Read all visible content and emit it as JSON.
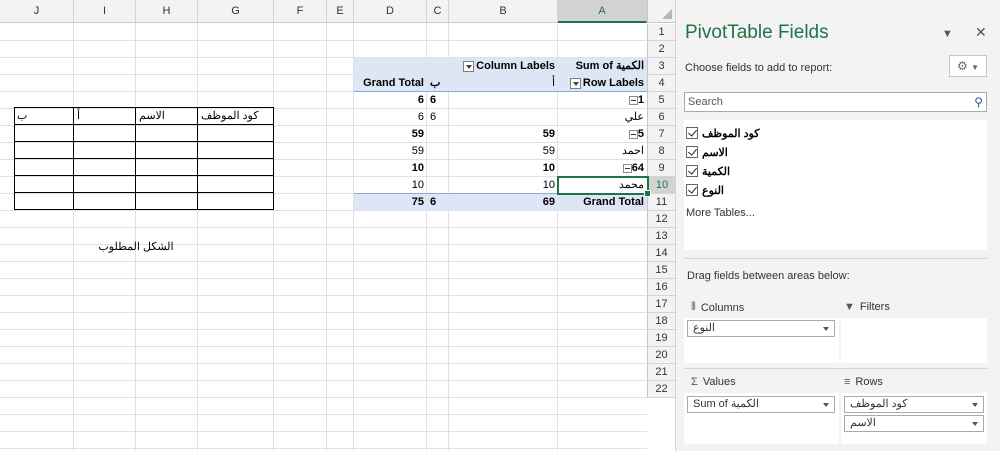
{
  "sheet": {
    "columns": [
      "J",
      "I",
      "H",
      "G",
      "F",
      "E",
      "D",
      "C",
      "B",
      "A"
    ],
    "selected_column": "A",
    "rows": [
      "1",
      "2",
      "3",
      "4",
      "5",
      "6",
      "7",
      "8",
      "9",
      "10",
      "11",
      "12",
      "13",
      "14",
      "15",
      "16",
      "17",
      "18",
      "19",
      "20",
      "21",
      "22"
    ],
    "selected_row": "10",
    "pivot": {
      "sum_label": "Sum of الكمية",
      "column_labels": "Column Labels",
      "row_labels": "Row Labels",
      "grand_total_col": "Grand Total",
      "col_b": "ب",
      "col_a": "أ",
      "rows": [
        {
          "a": "1",
          "label": "",
          "c": "6",
          "d": "6",
          "bold": true,
          "minus": true
        },
        {
          "a": "علي",
          "label": "",
          "c": "6",
          "d": "6",
          "bold": false,
          "minus": false
        },
        {
          "a": "5",
          "b": "59",
          "c": "",
          "d": "59",
          "bold": true,
          "minus": true
        },
        {
          "a": "احمد",
          "b": "59",
          "c": "",
          "d": "59",
          "bold": false,
          "minus": false
        },
        {
          "a": "64",
          "b": "10",
          "c": "",
          "d": "10",
          "bold": true,
          "minus": true
        },
        {
          "a": "محمد",
          "b": "10",
          "c": "",
          "d": "10",
          "bold": false,
          "minus": false
        }
      ],
      "grand_total_row": {
        "a": "Grand Total",
        "b": "69",
        "c": "6",
        "d": "75"
      }
    },
    "target_table": {
      "headers": [
        "كود الموظف",
        "الاسم",
        "أ",
        "ب"
      ],
      "caption": "الشكل المطلوب"
    }
  },
  "pane": {
    "title": "PivotTable Fields",
    "choose_text": "Choose fields to add to report:",
    "search_placeholder": "Search",
    "fields": [
      "كود الموظف",
      "الاسم",
      "الكمية",
      "النوع"
    ],
    "more_tables": "More Tables...",
    "drag_text": "Drag fields between areas below:",
    "areas": {
      "columns_label": "Columns",
      "filters_label": "Filters",
      "values_label": "Values",
      "rows_label": "Rows",
      "columns_items": [
        "النوع"
      ],
      "values_items": [
        "Sum of الكمية"
      ],
      "rows_items": [
        "كود الموظف",
        "الاسم"
      ]
    }
  }
}
